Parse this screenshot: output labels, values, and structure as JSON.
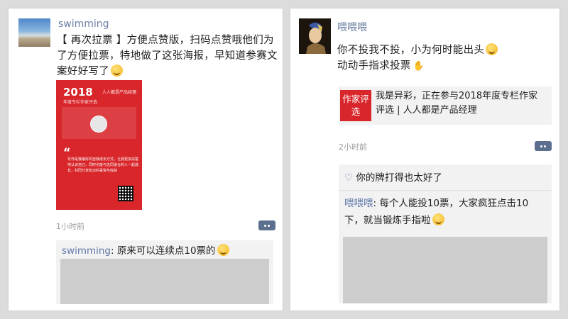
{
  "left_post": {
    "author": "swimming",
    "text": "【 再次拉票 】方便点赞版，扫码点赞哦他们为了方便拉票，特地做了这张海报，早知道参赛文案好好写了",
    "poster": {
      "year": "2018",
      "sub": "年度专栏作家评选",
      "logo": "人人都是产品经理",
      "quote_mark": "“",
      "body": "写作是我最好的自我成长方式，让我更加清楚地认识自己，同时也能与志同道合的人一起成长，共同分享知识的喜悦与收获"
    },
    "time": "1小时前",
    "comment": {
      "author": "swimming",
      "text": "原来可以连续点10票的"
    }
  },
  "right_post": {
    "author": "喂喂喂",
    "line1": "你不投我不投，小为何时能出头",
    "line2": "动动手指求投票",
    "link": {
      "icon_text": "作家评选",
      "text": "我是异彩，正在参与2018年度专栏作家评选 | 人人都是产品经理"
    },
    "time": "2小时前",
    "likes": "你的牌打得也太好了",
    "comment": {
      "author": "喂喂喂",
      "text": "每个人能投10票，大家疯狂点击10下，就当锻炼手指啦"
    }
  },
  "colors": {
    "name_blue": "#6b7fa3",
    "brand_red": "#d8262b"
  }
}
